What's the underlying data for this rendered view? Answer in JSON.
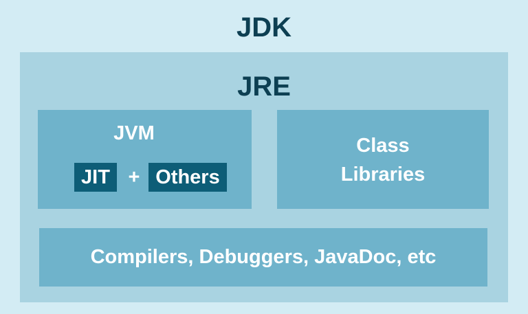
{
  "jdk": {
    "title": "JDK"
  },
  "jre": {
    "title": "JRE"
  },
  "jvm": {
    "title": "JVM",
    "jit_label": "JIT",
    "plus": "+",
    "others_label": "Others"
  },
  "class_libraries": {
    "label": "Class\nLibraries"
  },
  "tools": {
    "label": "Compilers, Debuggers, JavaDoc, etc"
  },
  "colors": {
    "background": "#d3ecf4",
    "jre_box": "#a9d3e1",
    "panel": "#6fb3cb",
    "chip": "#0d5d77",
    "title_text": "#0d3f52",
    "panel_text": "#ffffff"
  }
}
